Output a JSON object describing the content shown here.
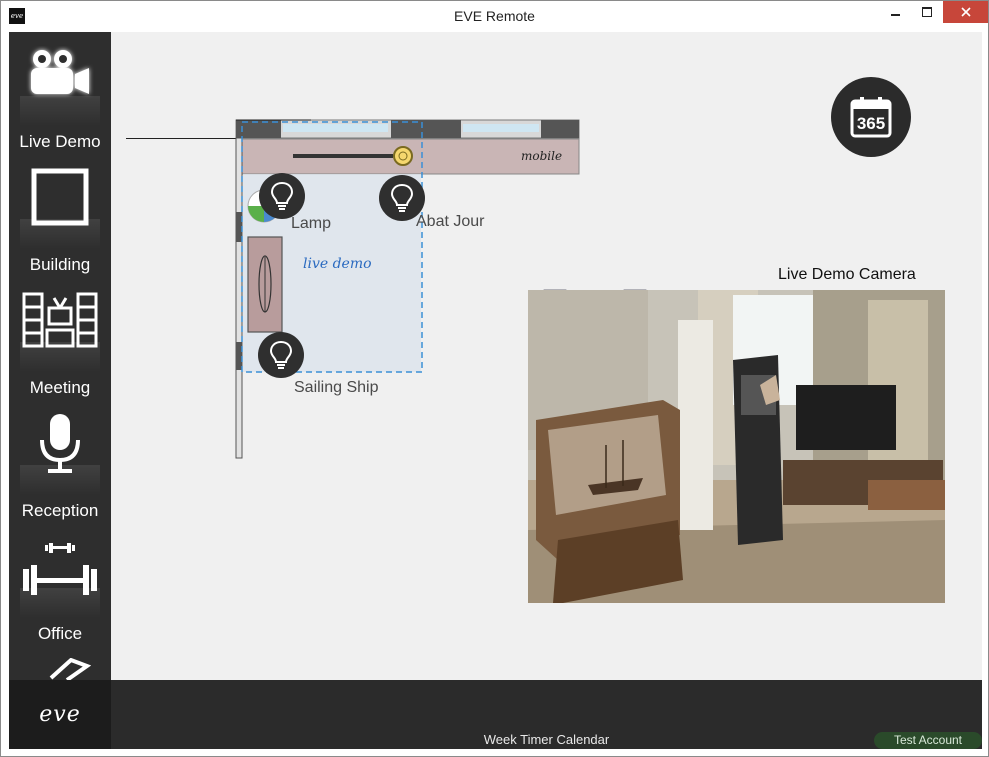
{
  "window": {
    "title": "EVE Remote",
    "app_icon_text": "eve"
  },
  "sidebar": {
    "items": [
      {
        "label": "Live Demo",
        "icon": "video-camera-icon",
        "active": true
      },
      {
        "label": "Building",
        "icon": "square-icon"
      },
      {
        "label": "Meeting",
        "icon": "meeting-room-icon"
      },
      {
        "label": "Reception",
        "icon": "microphone-icon"
      },
      {
        "label": "Office",
        "icon": "dumbbell-icon"
      }
    ],
    "logo_text": "eve"
  },
  "floorplan": {
    "mobile_label": "mobile",
    "room_label": "live demo",
    "devices": [
      {
        "label": "Lamp",
        "icon": "light-bulb-icon"
      },
      {
        "label": "Abat Jour",
        "icon": "light-bulb-icon"
      },
      {
        "label": "Sailing Ship",
        "icon": "light-bulb-icon"
      }
    ]
  },
  "calendar_button": {
    "icon": "calendar-365-icon",
    "text": "365"
  },
  "camera": {
    "title": "Live Demo Camera"
  },
  "footer": {
    "label": "Week Timer Calendar",
    "account": "Test Account"
  },
  "colors": {
    "sidebar_bg": "#2e2e2e",
    "main_bg": "#f0f0f0",
    "footer_bg": "#2b2b2b",
    "close_btn": "#c7463a",
    "plan_blue": "#3a8fd6",
    "account_green": "#2a4a2a"
  }
}
